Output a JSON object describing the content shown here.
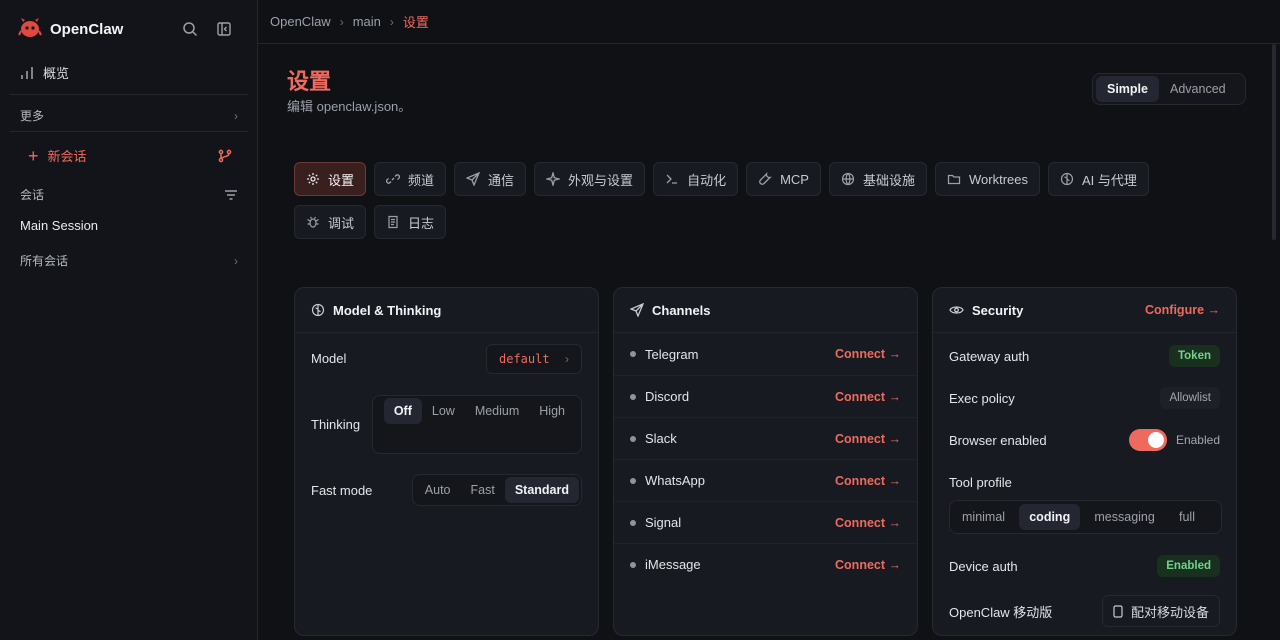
{
  "app": {
    "name": "OpenClaw"
  },
  "sidebar": {
    "overview": "概览",
    "more": "更多",
    "new_session": "新会话",
    "sessions_label": "会话",
    "current_session": "Main Session",
    "all_sessions": "所有会话"
  },
  "breadcrumb": [
    "OpenClaw",
    "main",
    "设置"
  ],
  "page": {
    "title": "设置",
    "subtitle": "编辑 openclaw.json。",
    "mode_simple": "Simple",
    "mode_advanced": "Advanced",
    "active_mode": "Simple"
  },
  "tabs": [
    {
      "label": "设置",
      "icon": "gear-icon",
      "active": true
    },
    {
      "label": "频道",
      "icon": "link-icon",
      "active": false
    },
    {
      "label": "通信",
      "icon": "send-icon",
      "active": false
    },
    {
      "label": "外观与设置",
      "icon": "sparkle-icon",
      "active": false
    },
    {
      "label": "自动化",
      "icon": "terminal-icon",
      "active": false
    },
    {
      "label": "MCP",
      "icon": "wrench-icon",
      "active": false
    },
    {
      "label": "基础设施",
      "icon": "globe-icon",
      "active": false
    },
    {
      "label": "Worktrees",
      "icon": "folder-icon",
      "active": false
    },
    {
      "label": "AI 与代理",
      "icon": "brain-icon",
      "active": false
    },
    {
      "label": "调试",
      "icon": "bug-icon",
      "active": false
    },
    {
      "label": "日志",
      "icon": "log-icon",
      "active": false
    }
  ],
  "model_card": {
    "title": "Model & Thinking",
    "model_label": "Model",
    "model_value": "default",
    "thinking_label": "Thinking",
    "thinking_options": [
      "Off",
      "Low",
      "Medium",
      "High"
    ],
    "thinking_selected": "Off",
    "fast_label": "Fast mode",
    "fast_options": [
      "Auto",
      "Fast",
      "Standard"
    ],
    "fast_selected": "Standard"
  },
  "channels_card": {
    "title": "Channels",
    "connect_label": "Connect →",
    "items": [
      "Telegram",
      "Discord",
      "Slack",
      "WhatsApp",
      "Signal",
      "iMessage"
    ]
  },
  "security_card": {
    "title": "Security",
    "configure_label": "Configure →",
    "gateway_auth_label": "Gateway auth",
    "gateway_auth_value": "Token",
    "exec_policy_label": "Exec policy",
    "exec_policy_value": "Allowlist",
    "browser_label": "Browser enabled",
    "browser_value": "Enabled",
    "tool_profile_label": "Tool profile",
    "tool_profile_options": [
      "minimal",
      "coding",
      "messaging",
      "full"
    ],
    "tool_profile_selected": "coding",
    "device_auth_label": "Device auth",
    "device_auth_value": "Enabled",
    "mobile_label": "OpenClaw 移动版",
    "pair_button": "配对移动设备"
  },
  "colors": {
    "accent": "#ef6a5e",
    "success": "#6fd48a",
    "background": "#0f1115",
    "card": "#171a20"
  }
}
